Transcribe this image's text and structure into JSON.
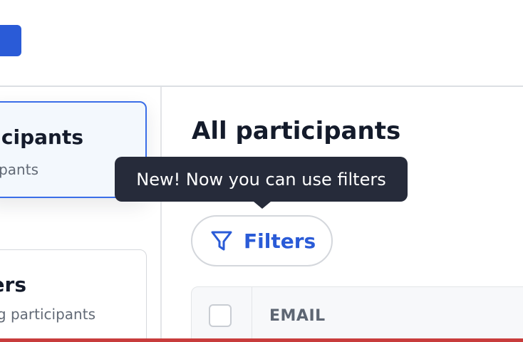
{
  "sidebar": {
    "cards": [
      {
        "title": "All participants",
        "subtitle": "All participants"
      },
      {
        "title": "Customers",
        "subtitle": "Paying participants"
      }
    ]
  },
  "main": {
    "title": "All participants",
    "filters_label": "Filters",
    "tooltip": "New! Now you can use filters",
    "table": {
      "columns": [
        "EMAIL"
      ]
    }
  },
  "icons": {
    "filter": "funnel-icon"
  },
  "colors": {
    "accent": "#2a5bd7",
    "tooltip_bg": "#262b3a",
    "active_card_border": "#3a6ee8",
    "bottom_bar": "#c83c3c"
  }
}
